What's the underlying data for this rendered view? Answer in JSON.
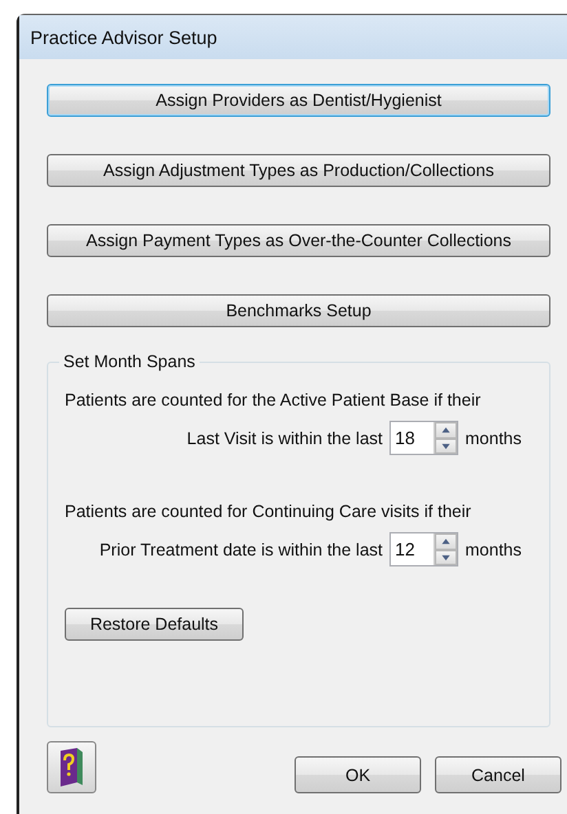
{
  "window": {
    "title": "Practice Advisor Setup"
  },
  "buttons": [
    {
      "label": "Assign Providers as Dentist/Hygienist",
      "focused": true
    },
    {
      "label": "Assign Adjustment Types as Production/Collections",
      "focused": false
    },
    {
      "label": "Assign Payment Types as Over-the-Counter Collections",
      "focused": false
    },
    {
      "label": "Benchmarks Setup",
      "focused": false
    }
  ],
  "month_spans": {
    "title": "Set Month Spans",
    "rules": [
      {
        "description": "Patients are counted for the Active Patient Base if their",
        "label": "Last Visit is within the last",
        "value": "18",
        "unit": "months"
      },
      {
        "description": "Patients are counted for Continuing Care visits if their",
        "label": "Prior Treatment date is within the last",
        "value": "12",
        "unit": "months"
      }
    ],
    "restore_button": "Restore Defaults"
  },
  "footer": {
    "ok": "OK",
    "cancel": "Cancel"
  }
}
